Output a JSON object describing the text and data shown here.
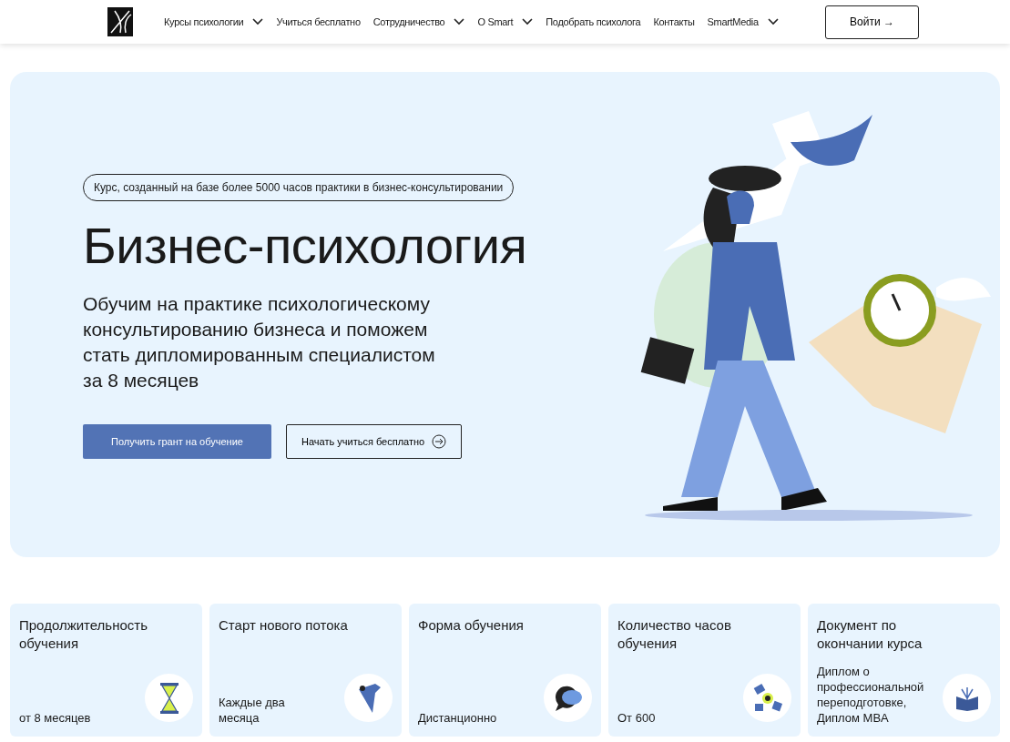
{
  "nav": {
    "items": [
      {
        "label": "Курсы психологии",
        "has_dropdown": true
      },
      {
        "label": "Учиться бесплатно",
        "has_dropdown": false
      },
      {
        "label": "Сотрудничество",
        "has_dropdown": true
      },
      {
        "label": "О Smart",
        "has_dropdown": true
      },
      {
        "label": "Подобрать психолога",
        "has_dropdown": false
      },
      {
        "label": "Контакты",
        "has_dropdown": false
      },
      {
        "label": "SmartMedia",
        "has_dropdown": true
      }
    ],
    "login": "Войти →"
  },
  "hero": {
    "badge": "Курс, созданный на базе более 5000 часов практики в бизнес-консультировании",
    "title": "Бизнес-психология",
    "subtitle": "Обучим на практике психологическому консультированию бизнеса и поможем стать дипломированным специалистом за 8 месяцев",
    "primary_button": "Получить грант на обучение",
    "secondary_button": "Начать учиться бесплатно"
  },
  "facts": [
    {
      "title": "Продолжительность обучения",
      "value": "от 8 месяцев",
      "kind": "hourglass"
    },
    {
      "title": "Старт нового потока",
      "value": "Каждые два месяца",
      "kind": "map"
    },
    {
      "title": "Форма обучения",
      "value": "Дистанционно",
      "kind": "chat"
    },
    {
      "title": "Количество часов обучения",
      "value": "От 600",
      "kind": "eye"
    },
    {
      "title": "Документ по окончании курса",
      "value": "Диплом о профессиональной переподготовке, Диплом MBA",
      "kind": "book"
    }
  ]
}
